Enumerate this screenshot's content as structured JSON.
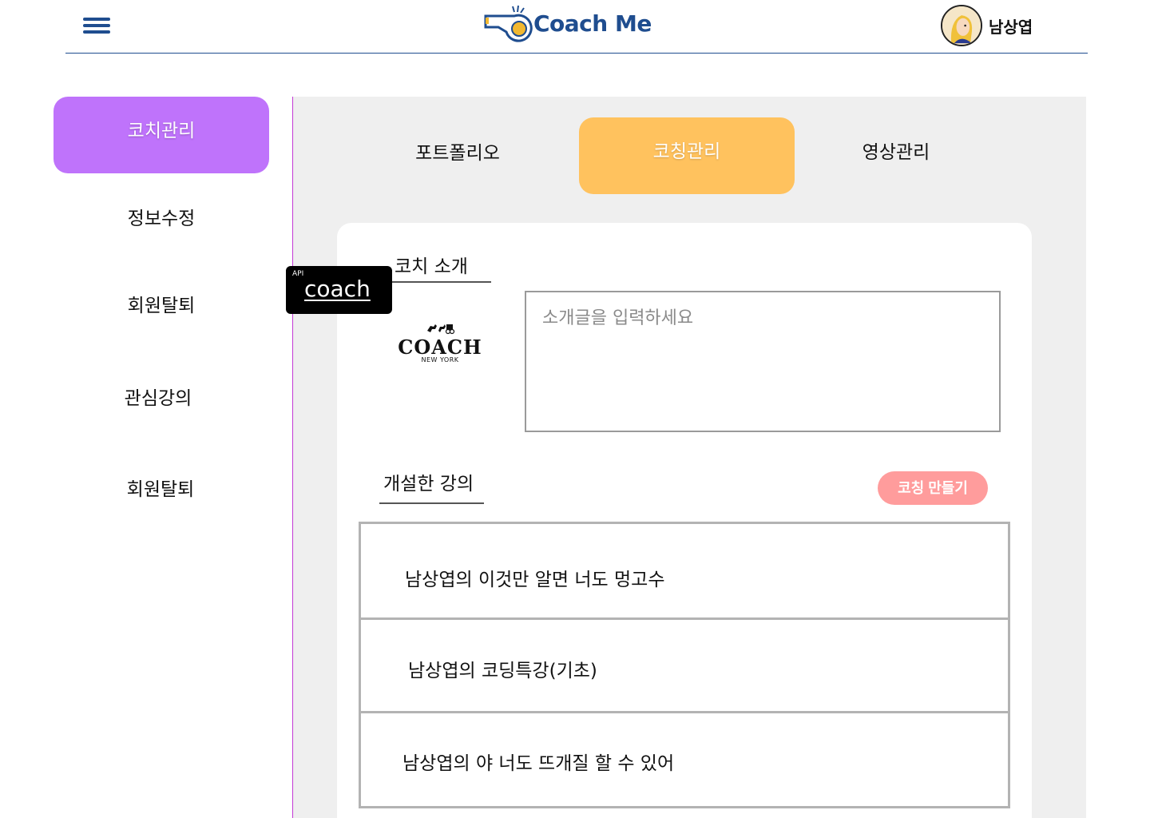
{
  "header": {
    "app_title": "Coach Me",
    "user_name": "남상엽",
    "brand_color": "#1f4d8f"
  },
  "sidebar": {
    "accent": "#bf73fb",
    "items": [
      {
        "label": "코치관리",
        "active": true
      },
      {
        "label": "정보수정",
        "active": false
      },
      {
        "label": "회원탈퇴",
        "active": false
      },
      {
        "label": "관심강의",
        "active": false
      },
      {
        "label": "회원탈퇴",
        "active": false
      }
    ]
  },
  "tabs": {
    "accent": "#ffc25e",
    "items": [
      {
        "label": "포트폴리오",
        "active": false
      },
      {
        "label": "코칭관리",
        "active": true
      },
      {
        "label": "영상관리",
        "active": false
      }
    ]
  },
  "intro": {
    "title": "코치 소개",
    "api_badge_small": "API",
    "api_badge_word": "coach",
    "brand_word": "COACH",
    "brand_sub": "NEW YORK",
    "placeholder": "소개글을 입력하세요",
    "value": ""
  },
  "courses": {
    "title": "개설한 강의",
    "create_button": "코칭 만들기",
    "create_button_color": "#ff9c9c",
    "items": [
      "남상엽의 이것만 알면 너도 멍고수",
      "남상엽의 코딩특강(기초)",
      "남상엽의 야 너도 뜨개질 할 수 있어"
    ]
  },
  "icons": {
    "menu": "hamburger-menu-icon",
    "logo": "whistle-logo-icon",
    "avatar": "user-avatar-icon"
  }
}
